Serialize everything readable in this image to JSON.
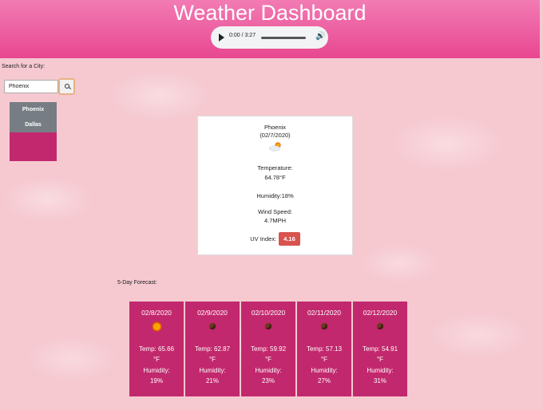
{
  "header": {
    "title": "Weather Dashboard"
  },
  "audio": {
    "time": "0:00 / 3:27"
  },
  "search": {
    "label": "Search for a City:",
    "value": "Phoenix",
    "placeholder": ""
  },
  "history": [
    "Phoenix",
    "Dallas"
  ],
  "current": {
    "city": "Phoenix",
    "date": "(02/7/2020)",
    "icon": "cloud-sun-icon",
    "temp_label": "Temperature:",
    "temp_value": "64.78°F",
    "humidity": "Humidity:18%",
    "wind_label": "Wind Speed:",
    "wind_value": "4.7MPH",
    "uv_label": "UV Index:",
    "uv_value": "4.16"
  },
  "forecast": {
    "label": "5-Day Forecast:",
    "days": [
      {
        "date": "02/8/2020",
        "icon": "sun-icon",
        "temp": "Temp: 65.66",
        "unit": "°F",
        "hum_label": "Humidity:",
        "hum": "19%"
      },
      {
        "date": "02/9/2020",
        "icon": "brown-dot-icon",
        "temp": "Temp: 62.87",
        "unit": "°F",
        "hum_label": "Humidity:",
        "hum": "21%"
      },
      {
        "date": "02/10/2020",
        "icon": "brown-dot-icon",
        "temp": "Temp: 59.92",
        "unit": "°F",
        "hum_label": "Humidity:",
        "hum": "23%"
      },
      {
        "date": "02/11/2020",
        "icon": "brown-dot-icon",
        "temp": "Temp: 57.13",
        "unit": "°F",
        "hum_label": "Humidity:",
        "hum": "27%"
      },
      {
        "date": "02/12/2020",
        "icon": "brown-dot-icon",
        "temp": "Temp: 54.91",
        "unit": "°F",
        "hum_label": "Humidity:",
        "hum": "31%"
      }
    ]
  },
  "colors": {
    "header": "#e8478f",
    "card": "#c2286d",
    "uv": "#d9534f",
    "history_btn": "#777d84"
  }
}
